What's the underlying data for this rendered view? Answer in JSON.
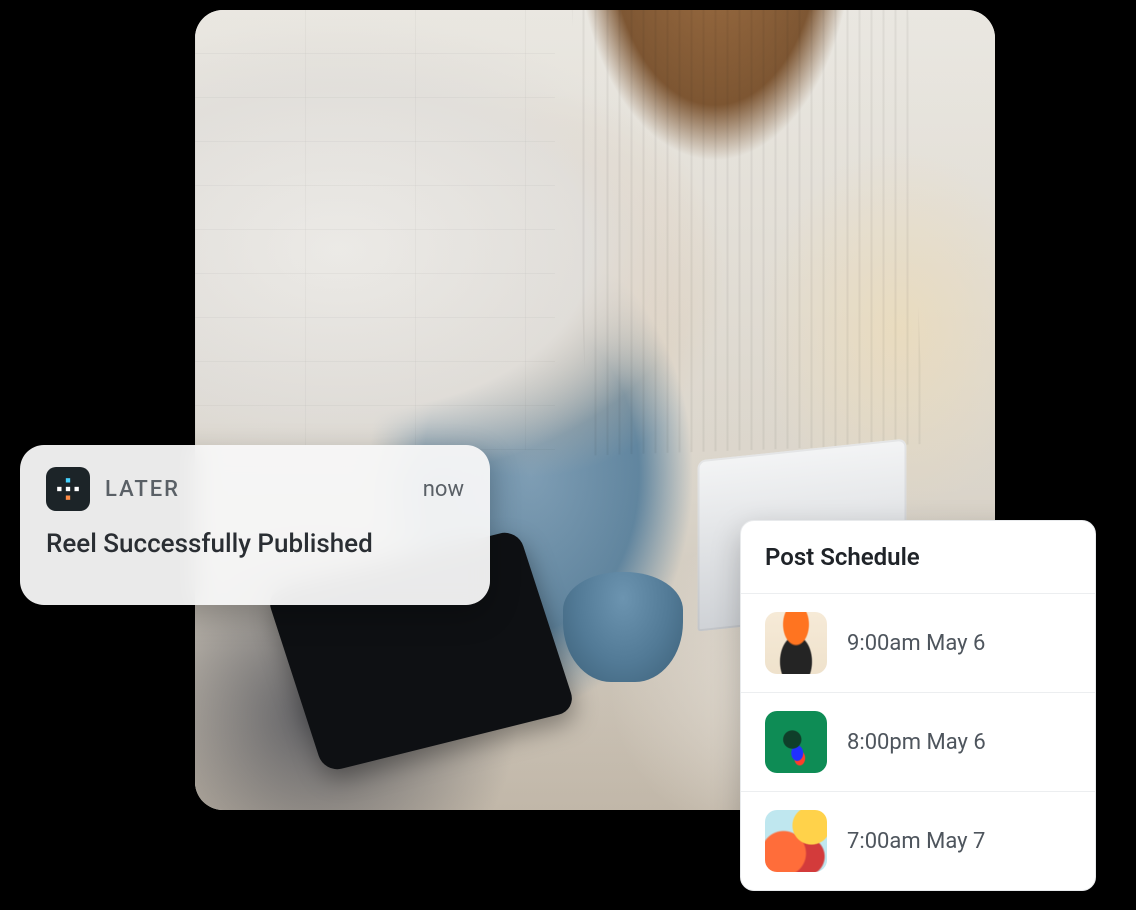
{
  "notification": {
    "app_icon": "later-app-icon",
    "app_name": "LATER",
    "timestamp": "now",
    "message": "Reel Successfully Published"
  },
  "schedule": {
    "title": "Post Schedule",
    "items": [
      {
        "thumb": "thumb-1",
        "time": "9:00am May 6"
      },
      {
        "thumb": "thumb-2",
        "time": "8:00pm May 6"
      },
      {
        "thumb": "thumb-3",
        "time": "7:00am May 7"
      }
    ]
  }
}
